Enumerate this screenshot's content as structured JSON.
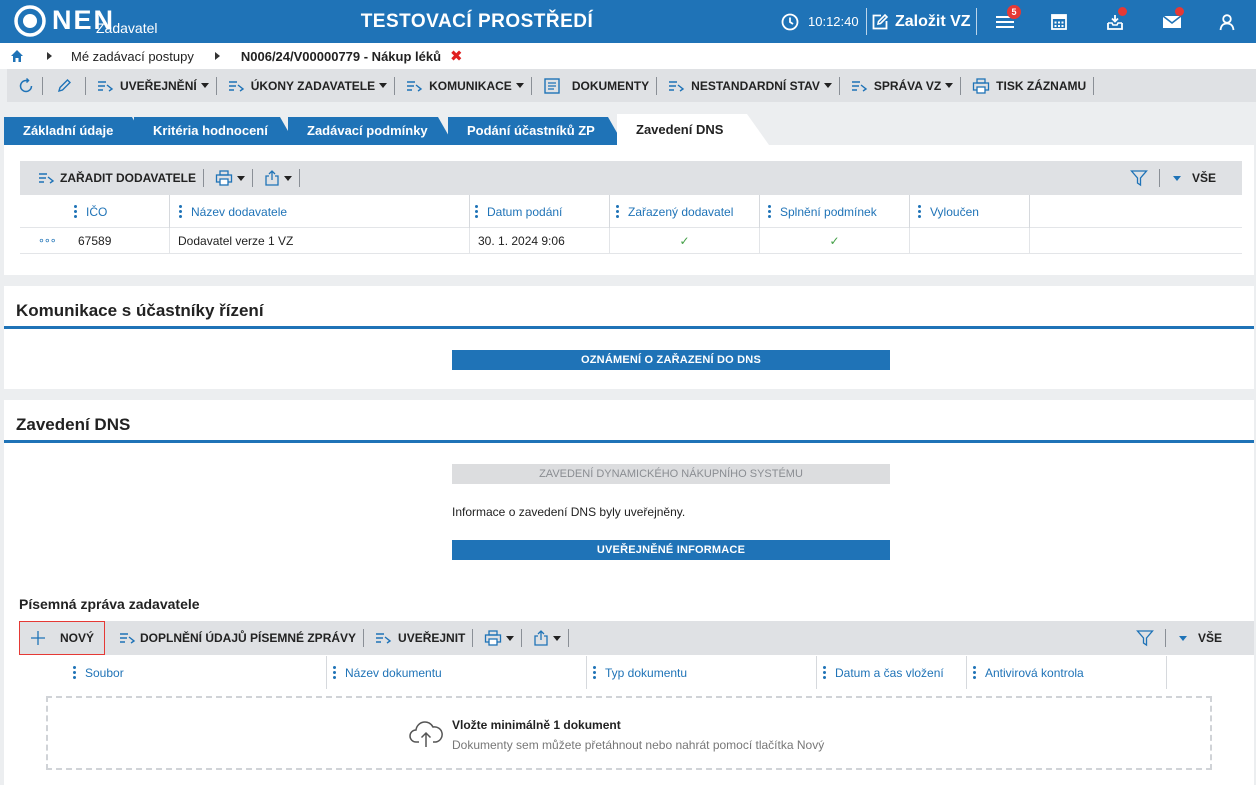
{
  "header": {
    "logo_text": "NEN",
    "logo_sub": "Zadavatel",
    "environment_title": "TESTOVACÍ PROSTŘEDÍ",
    "clock": "10:12:40",
    "create_label": "Založit VZ",
    "menu_badge": "5",
    "colors": {
      "bar": "#1f73b7",
      "badge": "#e53935"
    }
  },
  "breadcrumb": {
    "items": [
      "Mé zadávací postupy",
      "N006/24/V00000779 - Nákup léků"
    ],
    "close_glyph": "✖"
  },
  "toolbar": {
    "items": [
      "UVEŘEJNĚNÍ",
      "ÚKONY ZADAVATELE",
      "KOMUNIKACE",
      "DOKUMENTY",
      "NESTANDARDNÍ STAV",
      "SPRÁVA VZ",
      "TISK ZÁZNAMU"
    ]
  },
  "tabs": [
    "Základní údaje",
    "Kritéria hodnocení",
    "Zadávací podmínky",
    "Podání účastníků ZP",
    "Zavedení DNS"
  ],
  "active_tab": "Zavedení DNS",
  "suppliers": {
    "toolbar_label": "ZAŘADIT DODAVATELE",
    "filter_label": "VŠE",
    "columns": [
      "IČO",
      "Název dodavatele",
      "Datum podání",
      "Zařazený dodavatel",
      "Splnění podmínek",
      "Vyloučen"
    ],
    "rows": [
      {
        "menu": "∘∘∘",
        "ico": "67589",
        "name": "Dodavatel verze 1 VZ",
        "date": "30. 1. 2024 9:06",
        "assigned": "✓",
        "fulfilled": "✓",
        "excluded": ""
      }
    ]
  },
  "communication": {
    "title": "Komunikace s účastníky řízení",
    "button": "OZNÁMENÍ O ZAŘAZENÍ DO DNS"
  },
  "dns": {
    "title": "Zavedení DNS",
    "disabled_button": "ZAVEDENÍ DYNAMICKÉHO NÁKUPNÍHO SYSTÉMU",
    "info": "Informace o zavedení DNS byly uveřejněny.",
    "published_button": "UVEŘEJNĚNÉ INFORMACE"
  },
  "report": {
    "title": "Písemná zpráva zadavatele",
    "new_label": "NOVÝ",
    "supplement_label": "DOPLNĚNÍ ÚDAJŮ PÍSEMNÉ ZPRÁVY",
    "publish_label": "UVEŘEJNIT",
    "filter_label": "VŠE",
    "columns": [
      "Soubor",
      "Název dokumentu",
      "Typ dokumentu",
      "Datum a čas vložení",
      "Antivirová kontrola"
    ],
    "drop_title": "Vložte minimálně 1 dokument",
    "drop_hint": "Dokumenty sem můžete přetáhnout nebo nahrát pomocí tlačítka Nový"
  }
}
